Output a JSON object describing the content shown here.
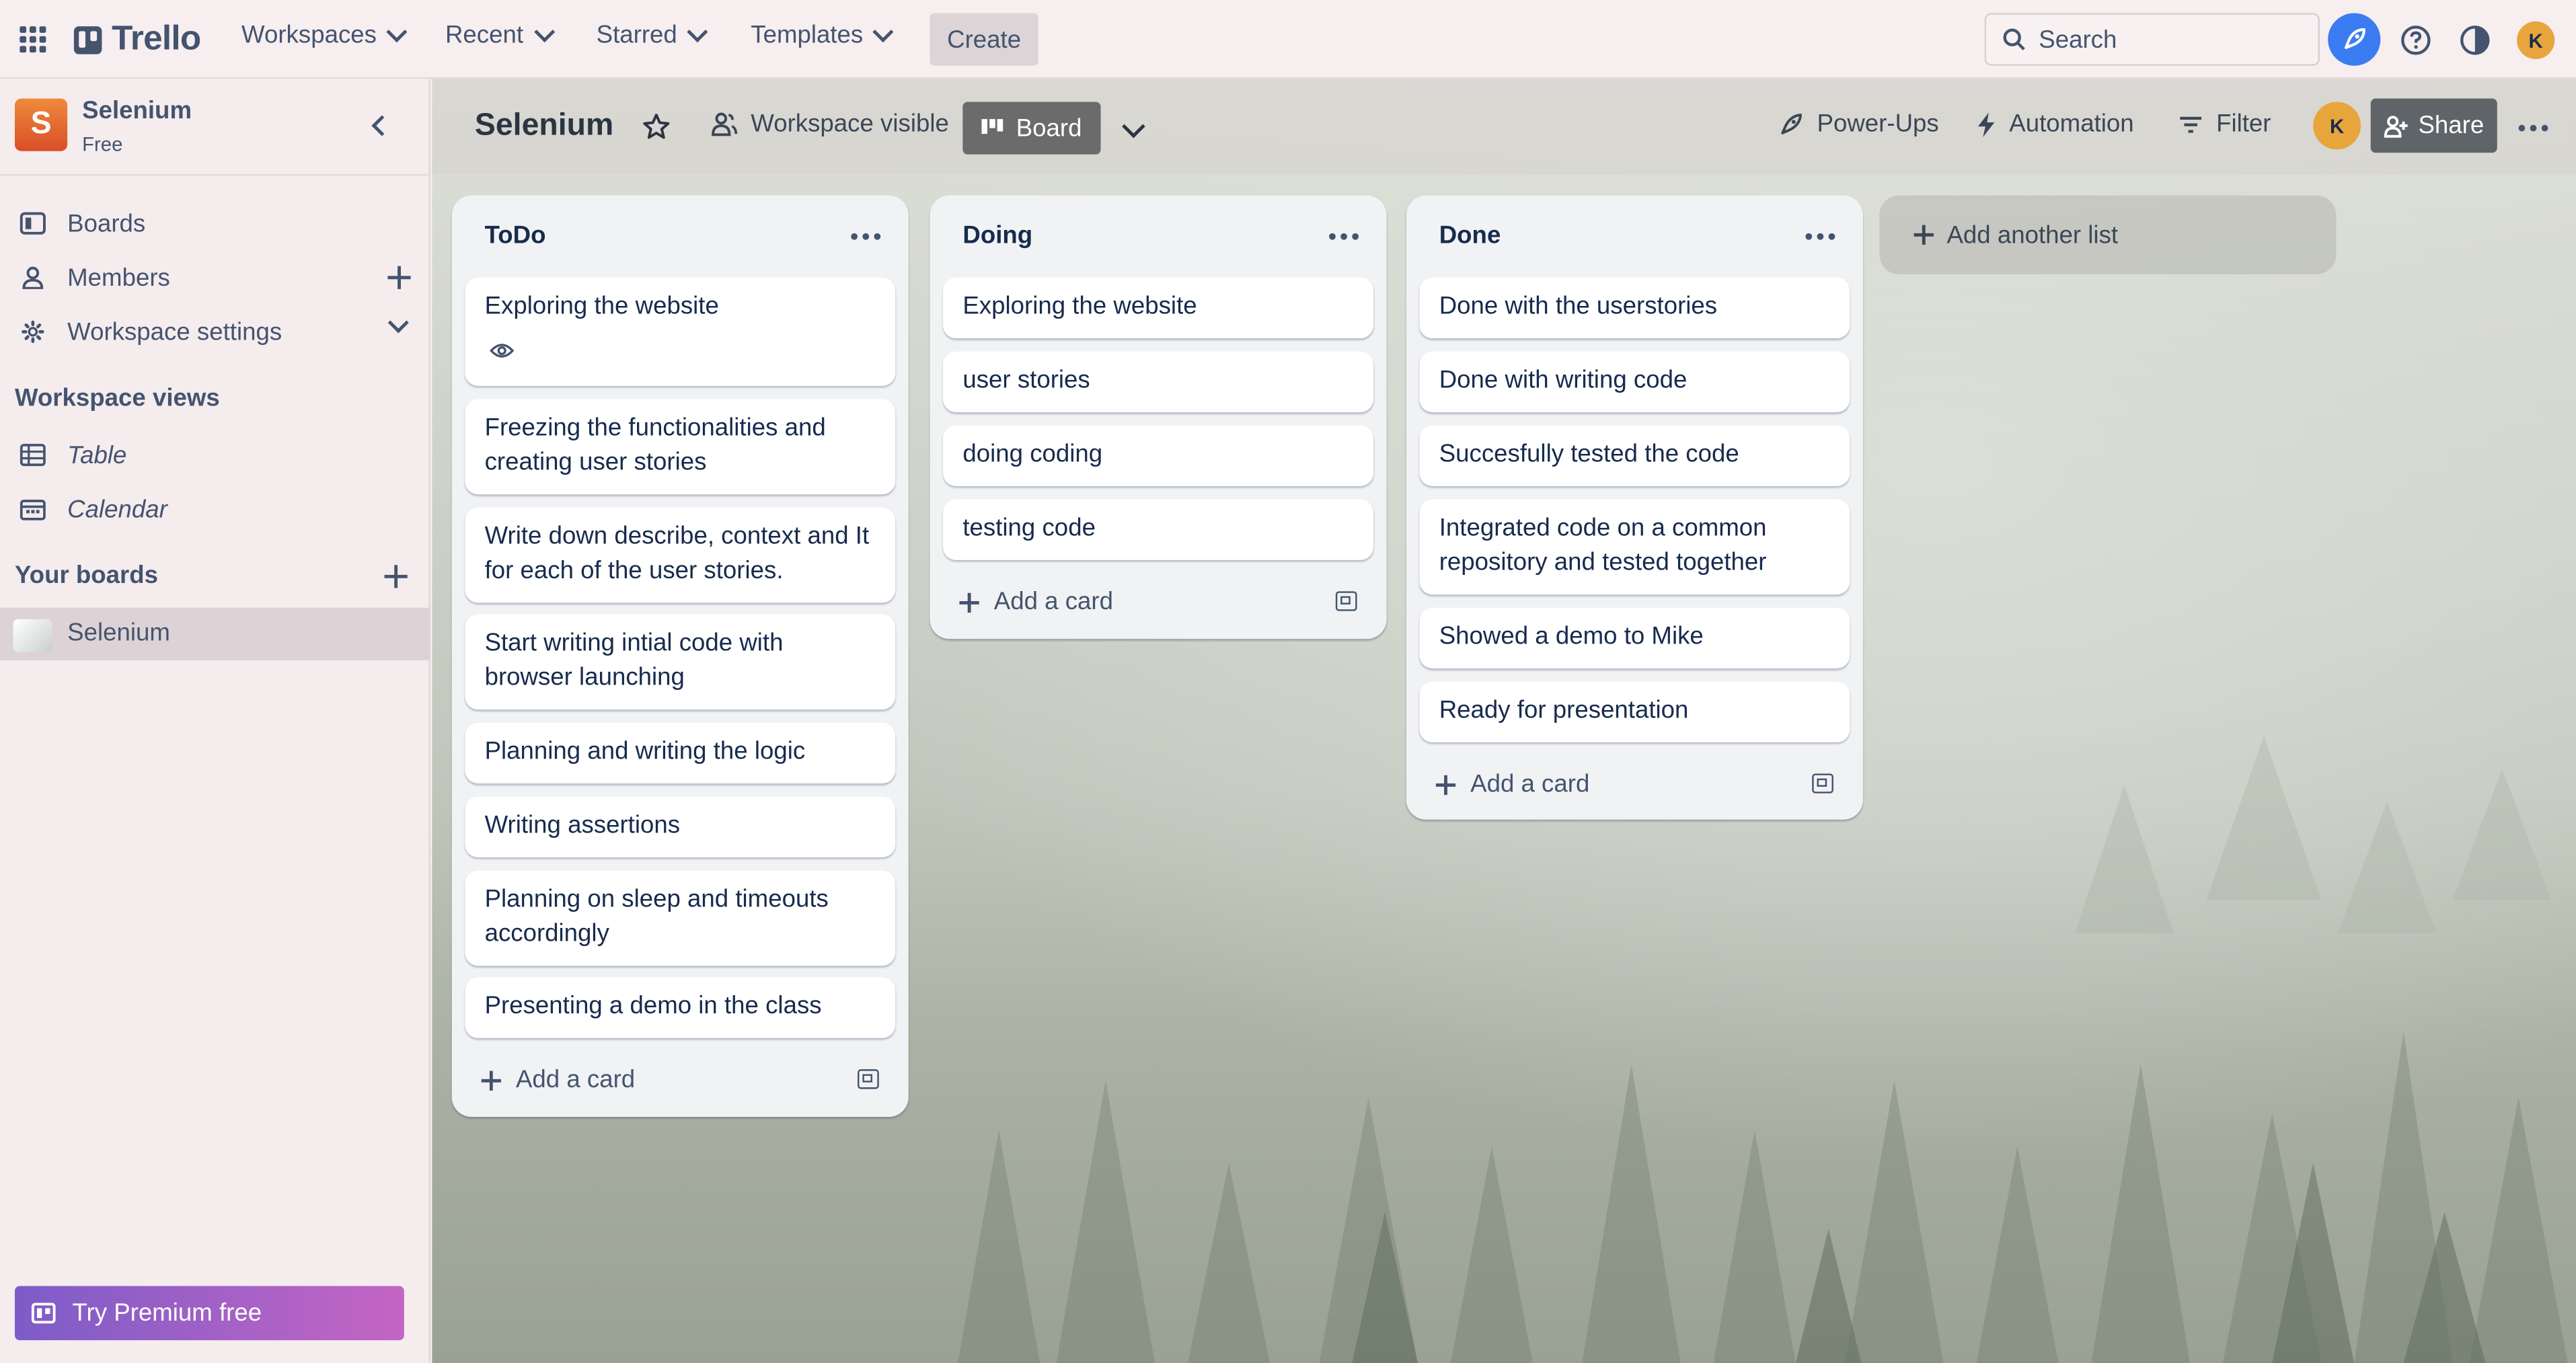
{
  "topnav": {
    "logo": "Trello",
    "menu": [
      {
        "label": "Workspaces"
      },
      {
        "label": "Recent"
      },
      {
        "label": "Starred"
      },
      {
        "label": "Templates"
      }
    ],
    "create_label": "Create",
    "search_placeholder": "Search",
    "avatar_initial": "K"
  },
  "sidebar": {
    "workspace_initial": "S",
    "workspace_name": "Selenium",
    "workspace_plan": "Free",
    "items": [
      {
        "label": "Boards"
      },
      {
        "label": "Members"
      },
      {
        "label": "Workspace settings"
      }
    ],
    "views_heading": "Workspace views",
    "views": [
      {
        "label": "Table"
      },
      {
        "label": "Calendar"
      }
    ],
    "your_boards_heading": "Your boards",
    "boards": [
      {
        "label": "Selenium"
      }
    ],
    "premium_label": "Try Premium free"
  },
  "board": {
    "title": "Selenium",
    "visibility_label": "Workspace visible",
    "view_label": "Board",
    "powerups_label": "Power-Ups",
    "automation_label": "Automation",
    "filter_label": "Filter",
    "member_initial": "K",
    "share_label": "Share",
    "add_list_label": "Add another list",
    "add_card_label": "Add a card",
    "lists": [
      {
        "title": "ToDo",
        "cards": [
          "Exploring the website",
          "Freezing the functionalities and creating user stories",
          "Write down describe, context and It for each of the user stories.",
          "Start writing intial code with browser launching",
          "Planning and writing the logic",
          "Writing assertions",
          "Planning on sleep and timeouts accordingly",
          "Presenting a demo in the class"
        ]
      },
      {
        "title": "Doing",
        "cards": [
          "Exploring the website",
          "user stories",
          "doing coding",
          "testing code"
        ]
      },
      {
        "title": "Done",
        "cards": [
          "Done with the userstories",
          "Done with writing code",
          "Succesfully tested the code",
          "Integrated code on a common repository and tested together",
          "Showed a demo to Mike",
          "Ready for presentation"
        ]
      }
    ]
  },
  "colors": {
    "accent_blue": "#3c7cf2",
    "avatar_orange": "#e8a53b",
    "workspace_logo": "#e4682f",
    "premium_gradient_start": "#7d5cc8",
    "premium_gradient_end": "#c465c4"
  }
}
